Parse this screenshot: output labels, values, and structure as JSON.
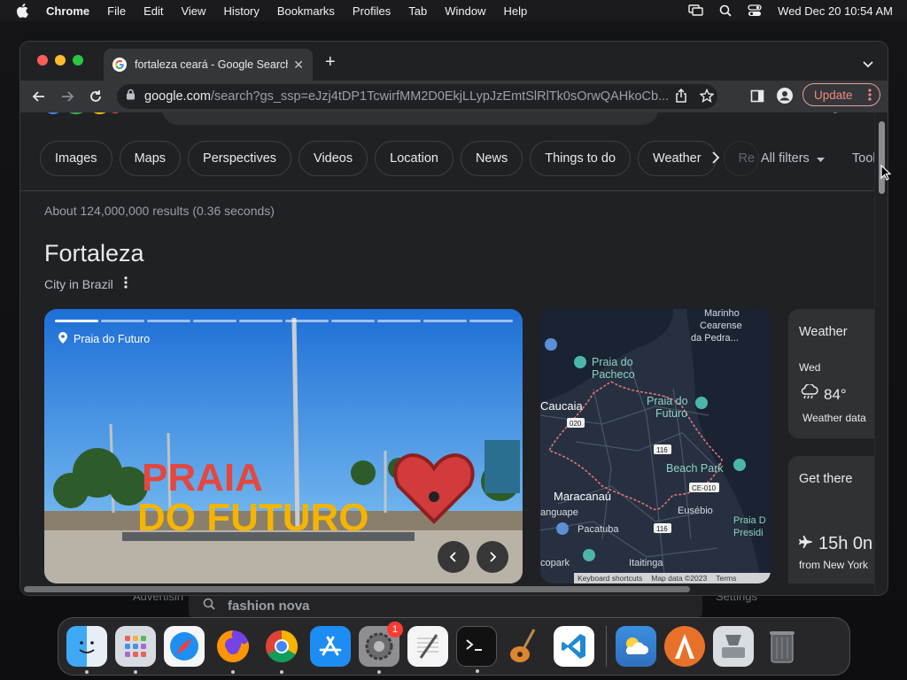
{
  "menubar": {
    "app_name": "Chrome",
    "items": [
      "File",
      "Edit",
      "View",
      "History",
      "Bookmarks",
      "Profiles",
      "Tab",
      "Window",
      "Help"
    ],
    "clock": "Wed Dec 20  10:54 AM"
  },
  "background": {
    "left_text": "Advertisin",
    "search_text": "fashion nova",
    "right_text": "Settings"
  },
  "tab": {
    "title": "fortaleza ceará - Google Search"
  },
  "toolbar": {
    "url_domain": "google.com",
    "url_rest": "/search?gs_ssp=eJzj4tDP1TcwirfMM2D0EkjLLypJzEmtSlRlTk0sOrwQAHkoCb...",
    "update_label": "Update"
  },
  "chips": [
    "Images",
    "Maps",
    "Perspectives",
    "Videos",
    "Location",
    "News",
    "Things to do",
    "Weather",
    "Re"
  ],
  "filters": {
    "all_filters": "All filters",
    "tools": "Tool"
  },
  "results": {
    "stats": "About 124,000,000 results (0.36 seconds)"
  },
  "entity": {
    "title": "Fortaleza",
    "subtitle": "City in Brazil"
  },
  "photo": {
    "location": "Praia do Futuro",
    "slides_total": 10,
    "slides_current": 1,
    "sign_line1": "PRAIA",
    "sign_line2": "DO FUTURO"
  },
  "map": {
    "labels": {
      "marinho": "Marinho",
      "cearense": "Cearense",
      "pedra": "da Pedra...",
      "pacheco1": "Praia do",
      "pacheco2": "Pacheco",
      "caucaia": "Caucaia",
      "futuro1": "Praia do",
      "futuro2": "Futuro",
      "beach_park": "Beach Park",
      "maracanau": "Maracanaú",
      "anguape": "anguape",
      "eusebio": "Eusébio",
      "pacatuba": "Pacatuba",
      "praiad": "Praia D",
      "presidi": "Presidi",
      "copark": "copark",
      "itaitinga": "Itaitinga",
      "r020": "020",
      "r116a": "116",
      "r116b": "116",
      "ce010": "CE-010"
    },
    "footer": [
      "Keyboard shortcuts",
      "Map data ©2023",
      "Terms"
    ]
  },
  "weather_card": {
    "title": "Weather",
    "day": "Wed",
    "temp": "84°",
    "note": "Weather data"
  },
  "getthere_card": {
    "title": "Get there",
    "time": "15h 0n",
    "from": "from New York"
  },
  "dock": {
    "settings_badge": "1"
  },
  "colors": {
    "page_bg": "#202124",
    "chip_border": "#3c4043",
    "update_accent": "#f28b82",
    "map_route": "#e57373"
  }
}
